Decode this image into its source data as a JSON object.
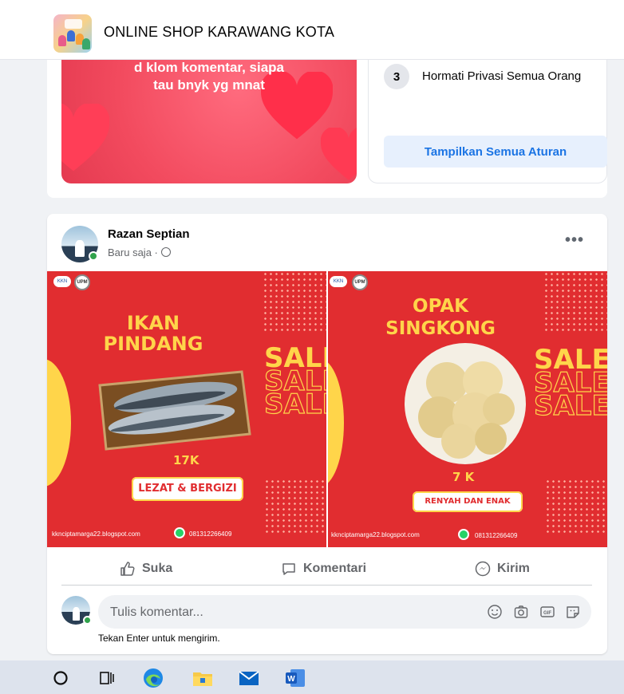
{
  "header": {
    "group_name": "ONLINE SHOP KARAWANG KOTA"
  },
  "previous_post": {
    "banner_text": "d klom komentar, siapa tau bnyk yg mnat",
    "rule_number": "3",
    "rule_text": "Hormati Privasi Semua Orang",
    "show_all_rules": "Tampilkan Semua Aturan"
  },
  "post": {
    "author": "Razan Septian",
    "time": "Baru saja ·",
    "more": "•••",
    "products": [
      {
        "title_line1": "IKAN",
        "title_line2": "PINDANG",
        "sale": "SALE",
        "price": "17K",
        "tagline": "LEZAT & BERGIZI",
        "website": "kknciptamarga22.blogspot.com",
        "phone": "081312266409"
      },
      {
        "title_line1": "OPAK",
        "title_line2": "SINGKONG",
        "sale": "SALE",
        "price": "7 K",
        "tagline": "RENYAH DAN ENAK",
        "website": "kknciptamarga22.blogspot.com",
        "phone": "081312266409"
      }
    ],
    "actions": {
      "like": "Suka",
      "comment": "Komentari",
      "share": "Kirim"
    },
    "comment_placeholder": "Tulis komentar...",
    "enter_hint": "Tekan Enter untuk mengirim."
  },
  "colors": {
    "brand_blue": "#1b74e4",
    "promo_red": "#e12d30",
    "promo_yellow": "#ffd54a",
    "online_green": "#31a24c"
  },
  "taskbar": {
    "icons": [
      "search-icon",
      "task-view-icon",
      "edge-icon",
      "file-explorer-icon",
      "mail-icon",
      "word-icon"
    ]
  }
}
